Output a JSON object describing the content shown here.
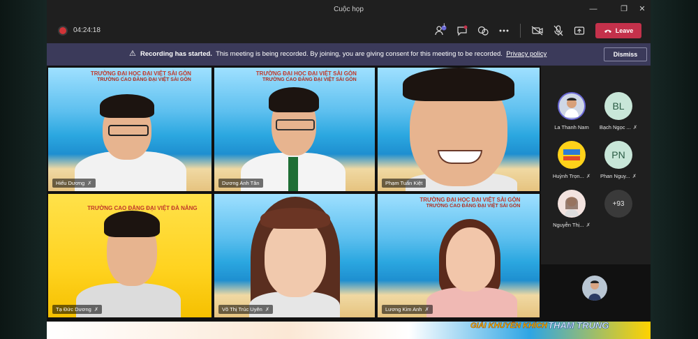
{
  "window": {
    "title": "Cuộc họp"
  },
  "toolbar": {
    "timer": "04:24:18",
    "people_badge": "1",
    "leave_label": "Leave"
  },
  "banner": {
    "bold": "Recording has started.",
    "text": "This meeting is being recorded. By joining, you are giving consent for this meeting to be recorded.",
    "link": "Privacy policy",
    "dismiss": "Dismiss"
  },
  "tiles": [
    {
      "name": "Hiếu Dương",
      "school": "TRƯỜNG ĐẠI HỌC ĐẠI VIỆT SÀI GÒN",
      "school2": "TRƯỜNG CAO ĐẲNG ĐẠI VIỆT SÀI GÒN"
    },
    {
      "name": "Dương Anh Tân",
      "school": "TRƯỜNG ĐẠI HỌC ĐẠI VIỆT SÀI GÒN",
      "school2": "TRƯỜNG CAO ĐẲNG ĐẠI VIỆT SÀI GÒN"
    },
    {
      "name": "Phạm Tuấn Kiệt"
    },
    {
      "name": "Tạ Đức Dương",
      "school": "TRƯỜNG CAO ĐẲNG ĐẠI VIỆT ĐÀ NẴNG"
    },
    {
      "name": "Võ Thị Trúc Uyên"
    },
    {
      "name": "Lương Kim Anh",
      "school": "TRƯỜNG ĐẠI HỌC ĐẠI VIỆT SÀI GÒN",
      "school2": "TRƯỜNG CAO ĐẲNG ĐẠI VIỆT SÀI GÒN"
    }
  ],
  "roster": [
    {
      "name": "La Thanh Nam",
      "initials": ""
    },
    {
      "name": "Bạch Ngọc ...",
      "initials": "BL"
    },
    {
      "name": "Huỳnh Trọn...",
      "initials": ""
    },
    {
      "name": "Phan Nguy...",
      "initials": "PN"
    },
    {
      "name": "Nguyễn Thị...",
      "initials": ""
    },
    {
      "name": "",
      "initials": "+93"
    }
  ],
  "bottom": {
    "t1": "GIẢI KHUYẾN KHÍCH",
    "t2": "THAM TRÚNG"
  },
  "colors": {
    "accent": "#6b69d6",
    "leave": "#c4314b",
    "banner": "#3b3a5a",
    "record": "#d13438"
  }
}
